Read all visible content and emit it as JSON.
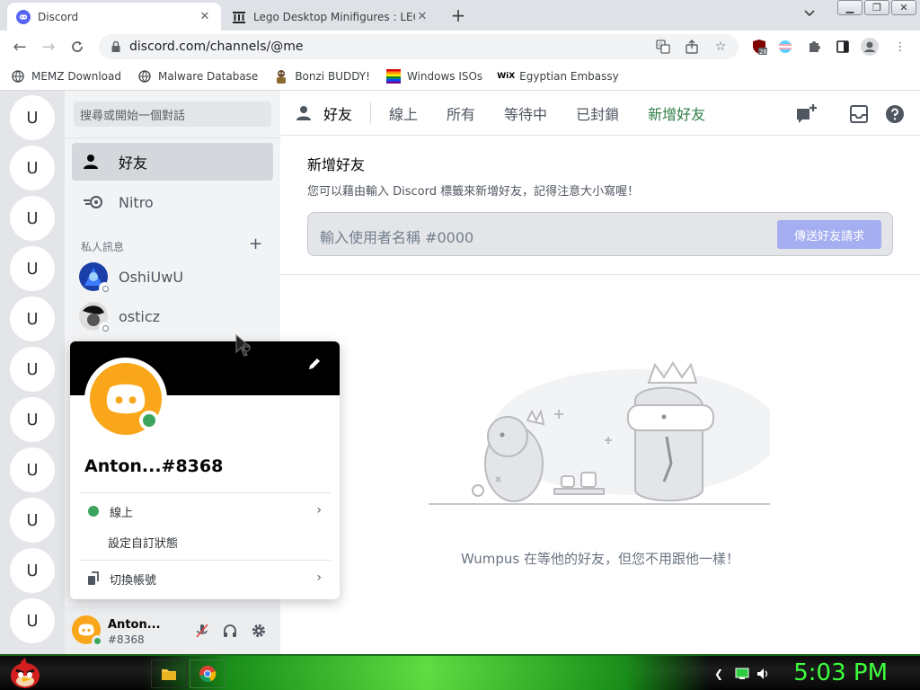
{
  "browser": {
    "tabs": [
      {
        "title": "Discord",
        "active": true
      },
      {
        "title": "Lego Desktop Minifigures : LEGO",
        "active": false
      }
    ],
    "url": "discord.com/channels/@me",
    "extension_badge": "26",
    "bookmarks": [
      {
        "label": "MEMZ Download",
        "icon": "globe-icon"
      },
      {
        "label": "Malware Database",
        "icon": "globe-icon"
      },
      {
        "label": "Bonzi BUDDY!",
        "icon": "bonzi-icon"
      },
      {
        "label": "Windows ISOs",
        "icon": "windows-icon"
      },
      {
        "label": "Egyptian Embassy",
        "icon": "wix-icon"
      }
    ],
    "wix_text": "WiX"
  },
  "guilds": {
    "items": [
      "U",
      "U",
      "U",
      "U",
      "U",
      "U",
      "U",
      "U",
      "U",
      "U",
      "U"
    ]
  },
  "dm": {
    "search_placeholder": "搜尋或開始一個對話",
    "nav": [
      {
        "label": "好友",
        "icon": "friends-icon",
        "selected": true
      },
      {
        "label": "Nitro",
        "icon": "nitro-icon",
        "selected": false
      }
    ],
    "section_title": "私人訊息",
    "users": [
      {
        "name": "OshiUwU"
      },
      {
        "name": "osticz"
      }
    ]
  },
  "userbar": {
    "name": "Anton...",
    "tag": "#8368"
  },
  "topbar": {
    "title": "好友",
    "tabs": [
      "線上",
      "所有",
      "等待中",
      "已封鎖"
    ],
    "add_friend": "新增好友"
  },
  "add_friend": {
    "heading": "新增好友",
    "subtitle": "您可以藉由輸入 Discord 標籤來新增好友，記得注意大小寫喔！",
    "input_placeholder": "輸入使用者名稱 #0000",
    "send_button": "傳送好友請求"
  },
  "empty_state": {
    "text": "Wumpus 在等他的好友，但您不用跟他一樣！"
  },
  "popout": {
    "name": "Anton...#8368",
    "status": "線上",
    "custom_status": "設定自訂狀態",
    "switch_account": "切換帳號"
  },
  "taskbar": {
    "clock": "5:03 PM"
  },
  "colors": {
    "blurple": "#5865f2",
    "green": "#3ba55d",
    "orange": "#faa61a"
  }
}
